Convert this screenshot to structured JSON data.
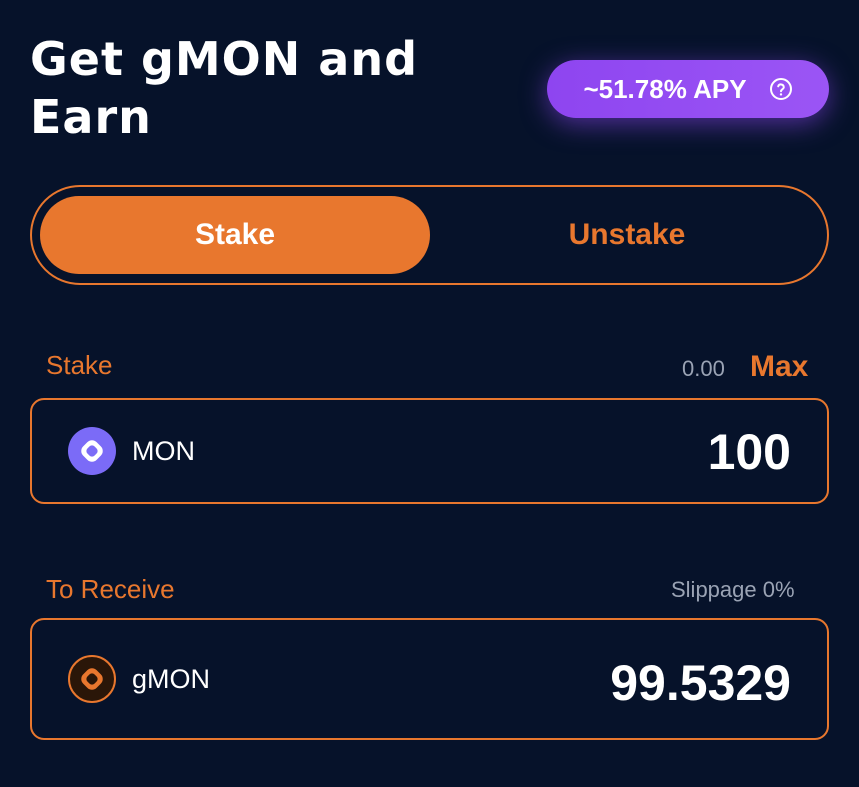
{
  "header": {
    "title_line1": "Get gMON and",
    "title_line2": "Earn",
    "apy_label": "~51.78% APY",
    "help_icon": "question-circle-icon"
  },
  "toggle": {
    "stake_label": "Stake",
    "unstake_label": "Unstake",
    "active": "Stake"
  },
  "stake": {
    "label": "Stake",
    "balance": "0.00",
    "max_label": "Max",
    "token": {
      "name": "MON",
      "icon": "mon-token-icon"
    },
    "amount": "100"
  },
  "receive": {
    "label": "To Receive",
    "slippage": "Slippage 0%",
    "token": {
      "name": "gMON",
      "icon": "gmon-token-icon"
    },
    "amount": "99.5329"
  },
  "colors": {
    "background": "#06122a",
    "accent": "#e8772e",
    "apy_purple": "#9b55f5",
    "mon_purple": "#7b6bf7",
    "muted": "#9aa3b4"
  }
}
